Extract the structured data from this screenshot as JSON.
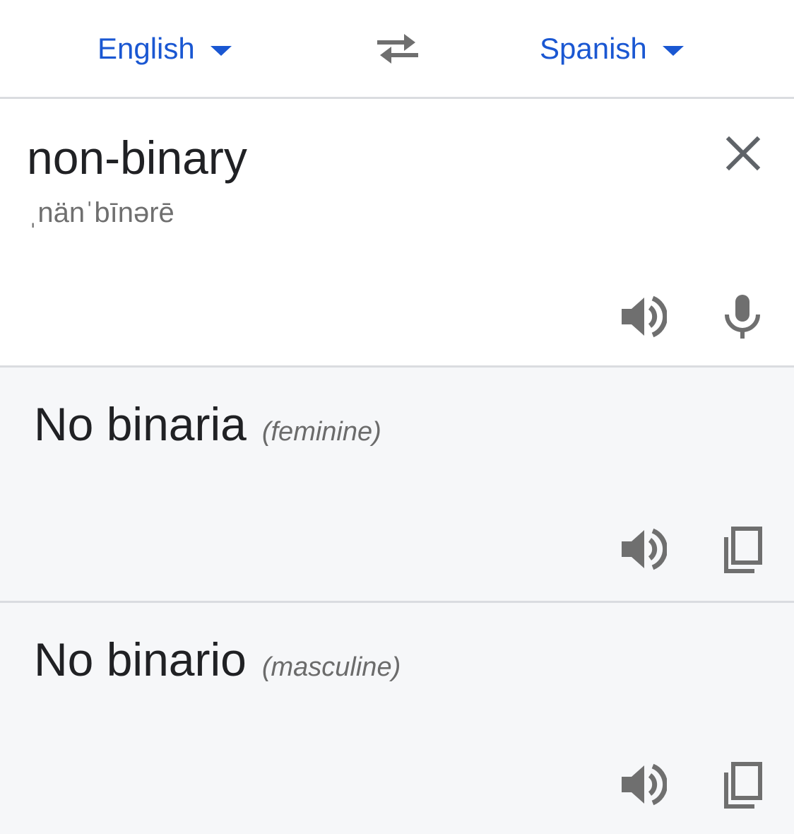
{
  "languages": {
    "source": "English",
    "target": "Spanish"
  },
  "input": {
    "text": "non-binary",
    "phonetic": "ˌnänˈbīnərē"
  },
  "results": [
    {
      "text": "No binaria",
      "gender": "(feminine)"
    },
    {
      "text": "No binario",
      "gender": "(masculine)"
    }
  ],
  "icons": {
    "caret": "caret-down-icon",
    "swap": "swap-arrows-icon",
    "clear": "close-icon",
    "speaker": "speaker-icon",
    "mic": "microphone-icon",
    "copy": "copy-icon"
  },
  "colors": {
    "accent": "#1a57d2",
    "icon": "#6f6f6f",
    "result_bg": "#f6f7f9",
    "divider": "#dadce0"
  }
}
